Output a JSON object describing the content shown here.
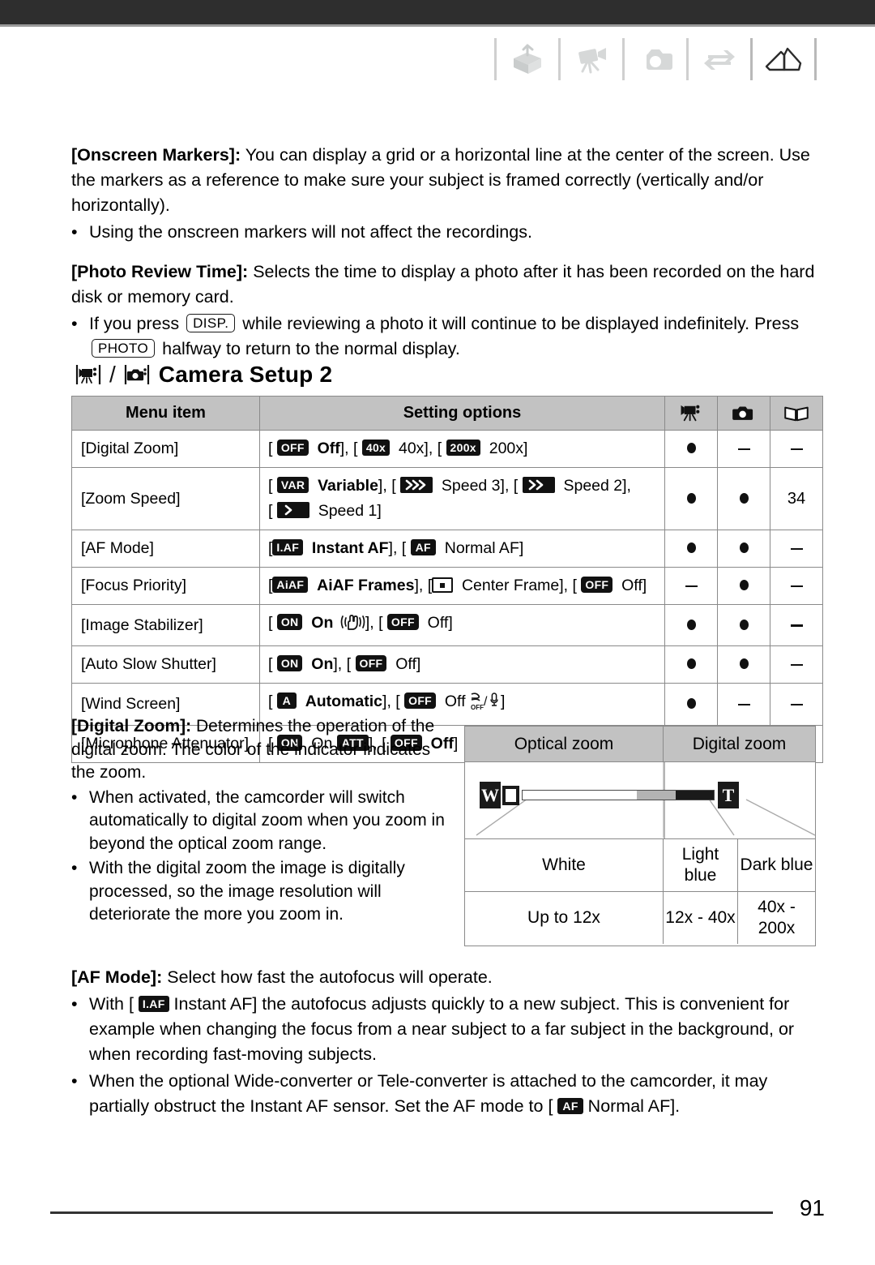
{
  "header": {
    "icons": [
      {
        "name": "open-box-icon",
        "state": "inactive"
      },
      {
        "name": "camcorder-icon",
        "state": "inactive"
      },
      {
        "name": "photo-camera-icon",
        "state": "inactive"
      },
      {
        "name": "transfer-arrows-icon",
        "state": "inactive"
      },
      {
        "name": "open-book-icon",
        "state": "active"
      }
    ]
  },
  "intro": {
    "onscreen_markers": {
      "term": "[Onscreen Markers]:",
      "text": " You can display a grid or a horizontal line at the center of the screen. Use the markers as a reference to make sure your subject is framed correctly (vertically and/or horizontally).",
      "bullets": [
        "Using the onscreen markers will not affect the recordings."
      ]
    },
    "photo_review_time": {
      "term": "[Photo Review Time]:",
      "text": " Selects the time to display a photo after it has been recorded on the hard disk or memory card.",
      "bullet_part1": "If you press ",
      "key_disp": "DISP.",
      "bullet_part2": " while reviewing a photo it will continue to be displayed indefinitely. Press ",
      "key_photo": "PHOTO",
      "bullet_part3": " halfway to return to the normal display."
    }
  },
  "section": {
    "title": "Camera Setup 2",
    "separator": "/",
    "icon_video": "camcorder-mode-icon",
    "icon_photo": "photo-mode-icon"
  },
  "table": {
    "headers": {
      "menu_item": "Menu item",
      "setting_options": "Setting options",
      "col_video": "camcorder-icon",
      "col_photo": "photo-camera-icon",
      "col_page": "open-book-icon"
    },
    "rows": [
      {
        "item": "[Digital Zoom]",
        "options": [
          {
            "badge": "OFF",
            "badge_style": "rounded",
            "label": "Off",
            "bold": true
          },
          {
            "badge": "40x",
            "badge_style": "rect",
            "label": "40x",
            "bold": false
          },
          {
            "badge": "200x",
            "badge_style": "rect",
            "label": "200x",
            "bold": false
          }
        ],
        "video": "dot",
        "photo": "dash",
        "page": "dash"
      },
      {
        "item": "[Zoom Speed]",
        "options": [
          {
            "badge": "VAR",
            "badge_style": "rect",
            "label": "Variable",
            "bold": true
          },
          {
            "badge": "arrow3",
            "badge_style": "arrow",
            "label": "Speed 3",
            "bold": false
          },
          {
            "badge": "arrow2",
            "badge_style": "arrow",
            "label": "Speed 2",
            "bold": false
          },
          {
            "badge": "arrow1",
            "badge_style": "arrow",
            "label": "Speed 1",
            "bold": false
          }
        ],
        "video": "dot",
        "photo": "dot",
        "page": "34"
      },
      {
        "item": "[AF Mode]",
        "options": [
          {
            "badge": "I.AF",
            "badge_style": "rect",
            "label": "Instant AF",
            "bold": true
          },
          {
            "badge": "AF",
            "badge_style": "rect",
            "label": "Normal AF",
            "bold": false
          }
        ],
        "video": "dot",
        "photo": "dot",
        "page": "dash"
      },
      {
        "item": "[Focus Priority]",
        "options": [
          {
            "badge": "AiAF",
            "badge_style": "rect",
            "label": "AiAF Frames",
            "bold": true
          },
          {
            "badge": "center-frame",
            "badge_style": "outline",
            "label": "Center Frame",
            "bold": false
          },
          {
            "badge": "OFF",
            "badge_style": "rounded",
            "label": "Off",
            "bold": false
          }
        ],
        "video": "dash",
        "photo": "dot",
        "page": "dash"
      },
      {
        "item": "[Image Stabilizer]",
        "options": [
          {
            "badge": "ON",
            "badge_style": "rounded",
            "label": "On",
            "bold": true,
            "trailing_icon": "hand-shake-icon"
          },
          {
            "badge": "OFF",
            "badge_style": "rounded",
            "label": "Off",
            "bold": false
          }
        ],
        "video": "dot",
        "photo": "dot",
        "page": "dash"
      },
      {
        "item": "[Auto Slow Shutter]",
        "options": [
          {
            "badge": "ON",
            "badge_style": "rounded",
            "label": "On",
            "bold": true
          },
          {
            "badge": "OFF",
            "badge_style": "rounded",
            "label": "Off",
            "bold": false
          }
        ],
        "video": "dot",
        "photo": "dot",
        "page": "dash"
      },
      {
        "item": "[Wind Screen]",
        "options": [
          {
            "badge": "A",
            "badge_style": "rect",
            "label": "Automatic",
            "bold": true
          },
          {
            "badge": "OFF",
            "badge_style": "rounded",
            "label": "Off",
            "bold": false,
            "trailing_icon": "wind-off-mic-icon"
          }
        ],
        "video": "dot",
        "photo": "dash",
        "page": "dash"
      },
      {
        "item": "[Microphone Attenuator]",
        "options": [
          {
            "badge": "ON",
            "badge_style": "rounded",
            "label": "On",
            "bold": false,
            "trailing_badge": "ATT"
          },
          {
            "badge": "OFF",
            "badge_style": "rounded",
            "label": "Off",
            "bold": true
          }
        ],
        "video": "dot",
        "photo": "dash",
        "page": "dash"
      }
    ]
  },
  "digital_zoom": {
    "term": "[Digital Zoom]:",
    "text": " Determines the operation of the digital zoom. The color of the indicator indicates the zoom.",
    "bullets": [
      "When activated, the camcorder will switch automatically to digital zoom when you zoom in beyond the optical zoom range.",
      "With the digital zoom the image is digitally processed, so the image resolution will deteriorate the more you zoom in."
    ]
  },
  "zoom_diagram": {
    "headers": [
      "Optical zoom",
      "Digital zoom"
    ],
    "colors": [
      "White",
      "Light blue",
      "Dark blue"
    ],
    "ranges": [
      "Up to 12x",
      "12x - 40x",
      "40x - 200x"
    ],
    "bar_labels": {
      "wide": "W",
      "tele": "T"
    },
    "bar_segments": [
      {
        "name": "optical",
        "color": "#ffffff"
      },
      {
        "name": "light-blue",
        "color": "#b3b3b3"
      },
      {
        "name": "dark-blue",
        "color": "#1a1a1a"
      }
    ]
  },
  "af_mode": {
    "term": "[AF Mode]:",
    "text": " Select how fast the autofocus will operate.",
    "bullet1_part1": "With [ ",
    "bullet1_badge": "I.AF",
    "bullet1_part2": " Instant AF] the autofocus adjusts quickly to a new subject. This is convenient for example when changing the focus from a near subject to a far subject in the background, or when recording fast-moving subjects.",
    "bullet2_part1": "When the optional Wide-converter or Tele-converter is attached to the camcorder, it may partially obstruct the Instant AF sensor. Set the AF mode to [ ",
    "bullet2_badge": "AF",
    "bullet2_part2": " Normal AF]."
  },
  "footer": {
    "page_number": "91"
  }
}
